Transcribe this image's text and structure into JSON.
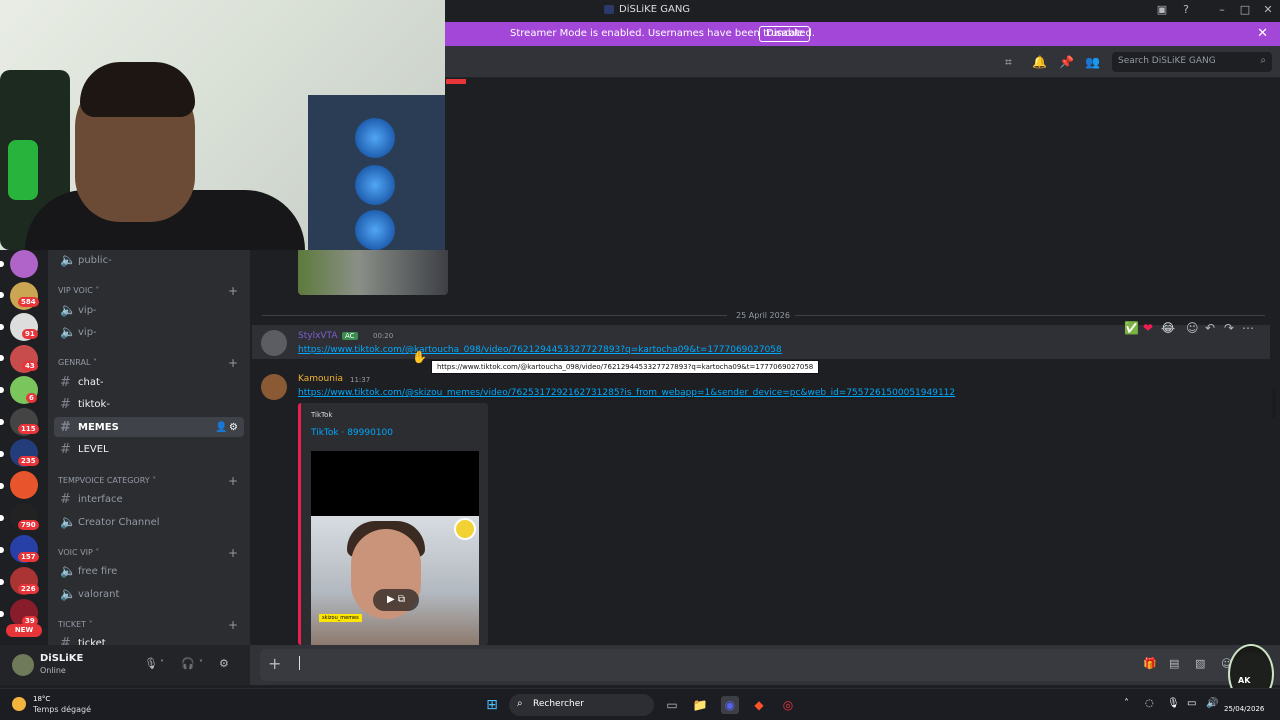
{
  "window": {
    "title": "DiSLiKE GANG"
  },
  "banner": {
    "message": "Streamer Mode is enabled. Usernames have been truncated.",
    "disable_label": "Disable"
  },
  "header": {
    "search_placeholder": "Search DiSLiKE GANG"
  },
  "servers": {
    "badges": [
      "584",
      "91",
      "43",
      "6",
      "115",
      "235",
      "790",
      "157",
      "226",
      "39"
    ],
    "new_label": "NEW"
  },
  "channels": {
    "public_label": "public-",
    "vip_category": "VIP VOIC",
    "vip1": "vip-",
    "vip2": "vip-",
    "genral_category": "GENRAL",
    "chat": "chat-",
    "tiktok": "tiktok-",
    "memes": "MEMES",
    "level": "LEVEL",
    "tempvoice_category": "TEMPVOICE CATEGORY",
    "interface": "interface",
    "creator": "Creator Channel",
    "voicvip_category": "voic vip",
    "freefire": "free fire",
    "valorant": "valorant",
    "ticket_category": "ticket",
    "ticket": "ticket"
  },
  "chat": {
    "date_separator": "25 April 2026",
    "message1": {
      "author": "StylxVTA",
      "tag": "AC",
      "time": "00:20",
      "link": "https://www.tiktok.com/@kartoucha_098/video/7621294453327727893?q=kartocha09&t=1777069027058",
      "tooltip": "https://www.tiktok.com/@kartoucha_098/video/7621294453327727893?q=kartocha09&t=1777069027058"
    },
    "message2": {
      "author": "Kamounia",
      "time": "11:37",
      "link": "https://www.tiktok.com/@skizou_memes/video/7625317292162731285?is_from_webapp=1&sender_device=pc&web_id=7557261500051949112",
      "embed_provider": "TikTok",
      "embed_title": "TikTok · 89990100",
      "video_tag": "skizou_memes"
    }
  },
  "user": {
    "name": "DiSLiKE",
    "status": "Online"
  },
  "taskbar": {
    "weather_temp": "18°C",
    "weather_desc": "Temps dégagé",
    "search_label": "Rechercher",
    "date": "25/04/2026",
    "time_partial": ""
  },
  "watermark": {
    "text": "AK"
  },
  "colors": {
    "blurple": "#5865f2",
    "banner": "#a347d8",
    "link": "#00a8fc",
    "tiktok": "#ee1d52"
  }
}
